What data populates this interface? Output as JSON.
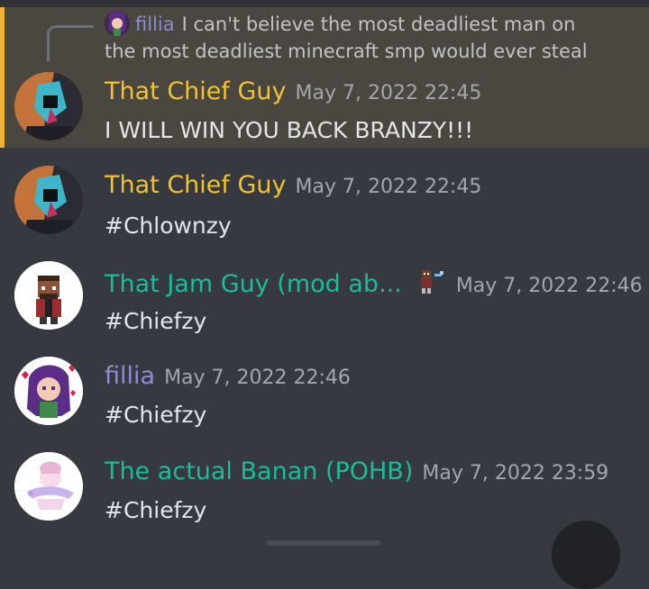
{
  "reply": {
    "author": "fillia",
    "preview": "I can't believe the most deadliest man on the most deadliest minecraft smp would ever steal"
  },
  "colors": {
    "background": "#36393f",
    "highlight": "#4a4640",
    "highlight_bar": "#f0b232",
    "name_gold": "#f1c232",
    "name_teal": "#1abc9c",
    "name_purple": "#8e8cd8"
  },
  "messages": [
    {
      "author": "That Chief Guy",
      "timestamp": "May 7, 2022 22:45",
      "text": "I WILL WIN YOU BACK BRANZY!!!",
      "avatar": "chief-avatar",
      "highlighted": true
    },
    {
      "author": "That Chief Guy",
      "timestamp": "May 7, 2022 22:45",
      "text": "#Chlownzy",
      "avatar": "chief-avatar"
    },
    {
      "author": "That Jam Guy (mod ab...",
      "timestamp": "May 7, 2022 22:46",
      "text": "#Chiefzy",
      "avatar": "jam-avatar",
      "badge": "pixel-character-badge"
    },
    {
      "author": "fillia",
      "timestamp": "May 7, 2022 22:46",
      "text": "#Chiefzy",
      "avatar": "fillia-avatar"
    },
    {
      "author": "The actual Banan (POHB)",
      "timestamp": "May 7, 2022 23:59",
      "text": "#Chiefzy",
      "avatar": "banan-avatar"
    }
  ]
}
